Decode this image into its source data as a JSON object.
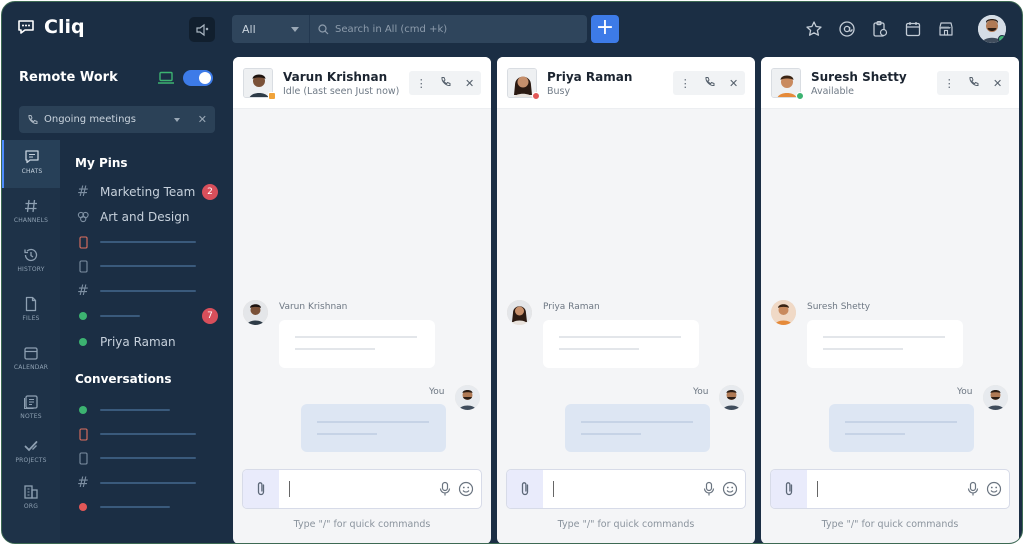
{
  "app": {
    "name": "Cliq"
  },
  "search": {
    "scope": "All",
    "placeholder": "Search in All (cmd +k)"
  },
  "sidebar": {
    "workspace": "Remote Work",
    "meetings_label": "Ongoing meetings",
    "rail": [
      {
        "label": "CHATS",
        "icon": "chat-icon",
        "active": true
      },
      {
        "label": "CHANNELS",
        "icon": "hash-icon"
      },
      {
        "label": "HISTORY",
        "icon": "history-icon"
      },
      {
        "label": "FILES",
        "icon": "file-icon"
      },
      {
        "label": "CALENDAR",
        "icon": "calendar-icon"
      },
      {
        "label": "NOTES",
        "icon": "notes-icon"
      },
      {
        "label": "PROJECTS",
        "icon": "projects-icon"
      },
      {
        "label": "ORG",
        "icon": "org-icon"
      }
    ],
    "pins_title": "My Pins",
    "pins": [
      {
        "label": "Marketing Team",
        "icon": "hash-icon",
        "badge": "2"
      },
      {
        "label": "Art and Design",
        "icon": "group-icon"
      },
      {
        "label": "",
        "icon": "device-icon"
      },
      {
        "label": "",
        "icon": "device-icon"
      },
      {
        "label": "",
        "icon": "hash-icon"
      },
      {
        "label": "",
        "icon": "online-dot",
        "badge": "7"
      },
      {
        "label": "Priya Raman",
        "icon": "online-dot"
      }
    ],
    "conversations_title": "Conversations"
  },
  "chats": [
    {
      "name": "Varun Krishnan",
      "status": "Idle (Last seen Just now)",
      "status_color": "#f0a33a",
      "sender": "Varun Krishnan",
      "you": "You",
      "hint": "Type \"/\" for quick commands"
    },
    {
      "name": "Priya Raman",
      "status": "Busy",
      "status_color": "#e25757",
      "sender": "Priya Raman",
      "you": "You",
      "hint": "Type \"/\" for quick commands"
    },
    {
      "name": "Suresh Shetty",
      "status": "Available",
      "status_color": "#3cb371",
      "sender": "Suresh Shetty",
      "you": "You",
      "hint": "Type \"/\" for quick commands"
    }
  ],
  "colors": {
    "sidebar": "#1b2e44",
    "accent": "#3d7be8",
    "badge": "#d84f5b"
  }
}
